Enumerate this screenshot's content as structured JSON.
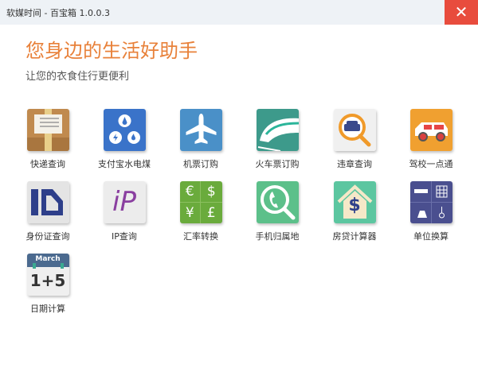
{
  "window": {
    "title": "软媒时间 - 百宝箱 1.0.0.3",
    "close": "✕"
  },
  "header": {
    "heading": "您身边的生活好助手",
    "subtitle": "让您的衣食住行更便利"
  },
  "tools": [
    {
      "label": "快递查询",
      "icon": "package-icon"
    },
    {
      "label": "支付宝水电煤",
      "icon": "utilities-icon"
    },
    {
      "label": "机票订购",
      "icon": "airplane-icon"
    },
    {
      "label": "火车票订购",
      "icon": "train-icon"
    },
    {
      "label": "违章查询",
      "icon": "car-search-icon"
    },
    {
      "label": "驾校一点通",
      "icon": "car-icon"
    },
    {
      "label": "身份证查询",
      "icon": "id-card-icon"
    },
    {
      "label": "IP查询",
      "icon": "ip-icon"
    },
    {
      "label": "汇率转换",
      "icon": "currency-icon"
    },
    {
      "label": "手机归属地",
      "icon": "phone-search-icon"
    },
    {
      "label": "房贷计算器",
      "icon": "house-loan-icon"
    },
    {
      "label": "单位换算",
      "icon": "unit-convert-icon"
    },
    {
      "label": "日期计算",
      "icon": "calendar-icon"
    }
  ],
  "icon_text": {
    "ip": "iP",
    "euro": "€",
    "dollar": "$",
    "yen": "¥",
    "pound": "£",
    "house_dollar": "$",
    "month": "March",
    "date_expr": "1+5"
  }
}
